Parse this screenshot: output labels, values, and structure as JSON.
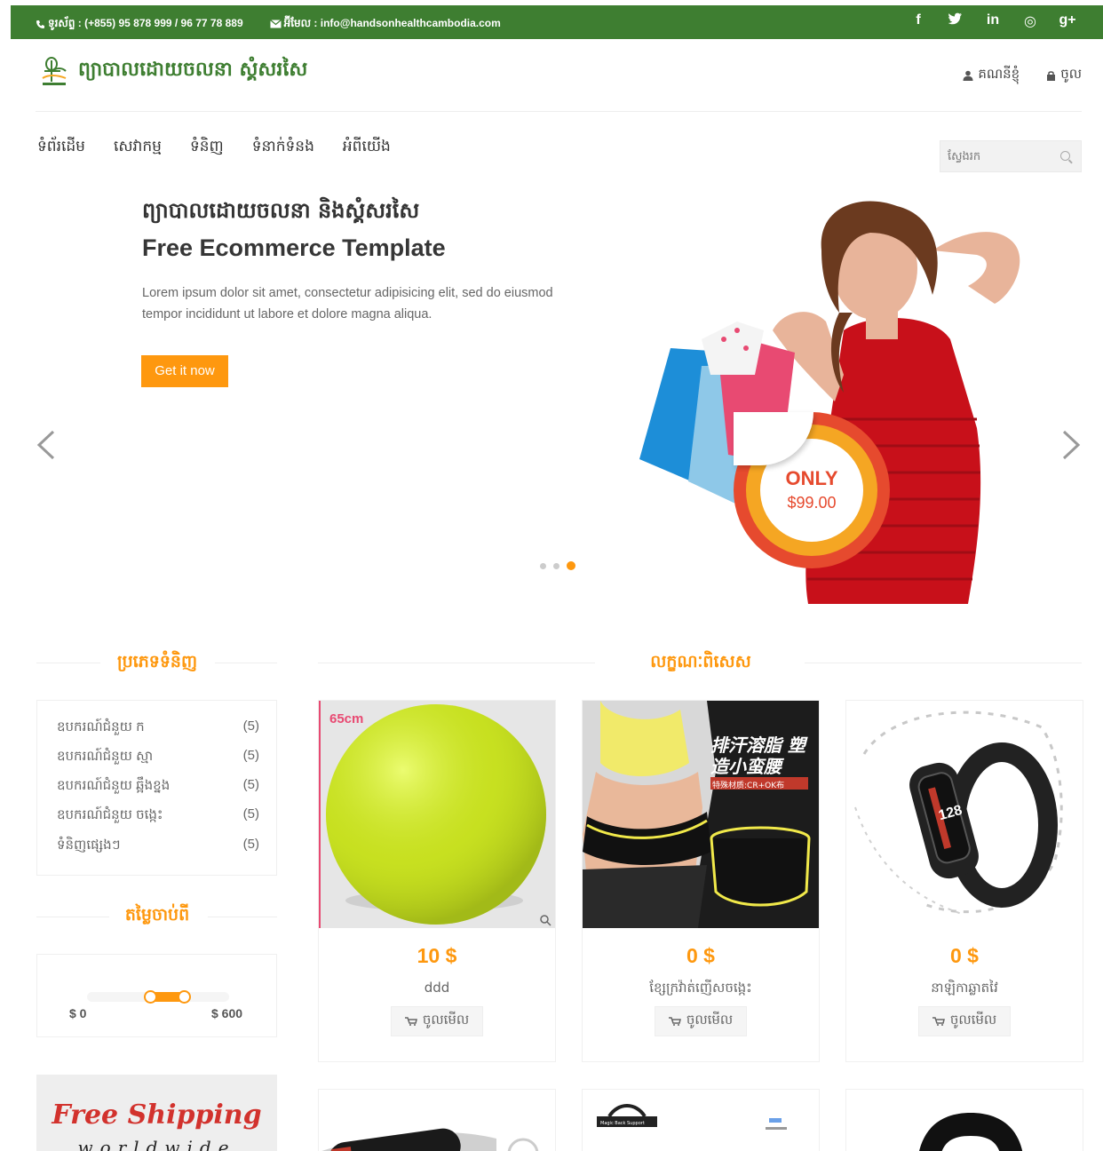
{
  "topbar": {
    "phone": "ទូរស័ព្ទ : (+855) 95 878 999 / 96 77 78 889",
    "email": "អ៊ីមែល : info@handsonhealthcambodia.com",
    "social": [
      "f",
      "t",
      "in",
      "◎",
      "g+"
    ]
  },
  "header": {
    "site_name": "ព្យាបាលដោយចលនា ស្គំសរសៃ",
    "account_label": "គណនីខ្ញុំ",
    "login_label": "ចូល"
  },
  "nav": {
    "items": [
      "ទំព័រដើម",
      "សេវាកម្ម",
      "ទំនិញ",
      "ទំនាក់ទំនង",
      "អំពីយើង"
    ],
    "search_placeholder": "ស្វែងរក"
  },
  "hero": {
    "title_km": "ព្យាបាលដោយចលនា និងស្គំសរសៃ",
    "title_en": "Free Ecommerce Template",
    "text": "Lorem ipsum dolor sit amet, consectetur adipisicing elit, sed do eiusmod tempor incididunt ut labore et dolore magna aliqua.",
    "cta_label": "Get it now",
    "badge_only": "ONLY",
    "badge_price": "$99.00",
    "slide_count": 3,
    "active_slide": 3
  },
  "sidebar": {
    "category_heading": "ប្រភេទទំនិញ",
    "categories": [
      {
        "label": "ឧបករណ៍ជំនួយ ក",
        "count": "(5)"
      },
      {
        "label": "ឧបករណ៍ជំនួយ ស្មា",
        "count": "(5)"
      },
      {
        "label": "ឧបករណ៍ជំនួយ ឆ្អឹងខ្នង",
        "count": "(5)"
      },
      {
        "label": "ឧបករណ៍ជំនួយ ចង្កេះ",
        "count": "(5)"
      },
      {
        "label": "ទំនិញផ្សេងៗ",
        "count": "(5)"
      }
    ],
    "price_heading": "តម្លៃចាប់ពី",
    "price_min": "$ 0",
    "price_max": "$ 600",
    "shipping_title": "Free Shipping",
    "shipping_sub": "worldwide"
  },
  "features": {
    "heading": "លក្ខណៈពិសេស",
    "products": [
      {
        "price": "10 $",
        "name": "ddd",
        "button": "ចូលមើល",
        "image_label": "65cm"
      },
      {
        "price": "0 $",
        "name": "ខ្សែក្រវ៉ាត់ញើសចង្កេះ",
        "button": "ចូលមើល",
        "image_label": "排汗溶脂 塑造小蛮腰",
        "image_sub": "特殊材质:CR+OK布"
      },
      {
        "price": "0 $",
        "name": "នាឡិកាឆ្លាតវៃ",
        "button": "ចូលមើល",
        "image_label": "128"
      }
    ],
    "next_row_label": "Magic Back Support"
  },
  "colors": {
    "brand_green": "#3e7e31",
    "accent_orange": "#fe980f",
    "badge_red": "#e64a2e"
  }
}
